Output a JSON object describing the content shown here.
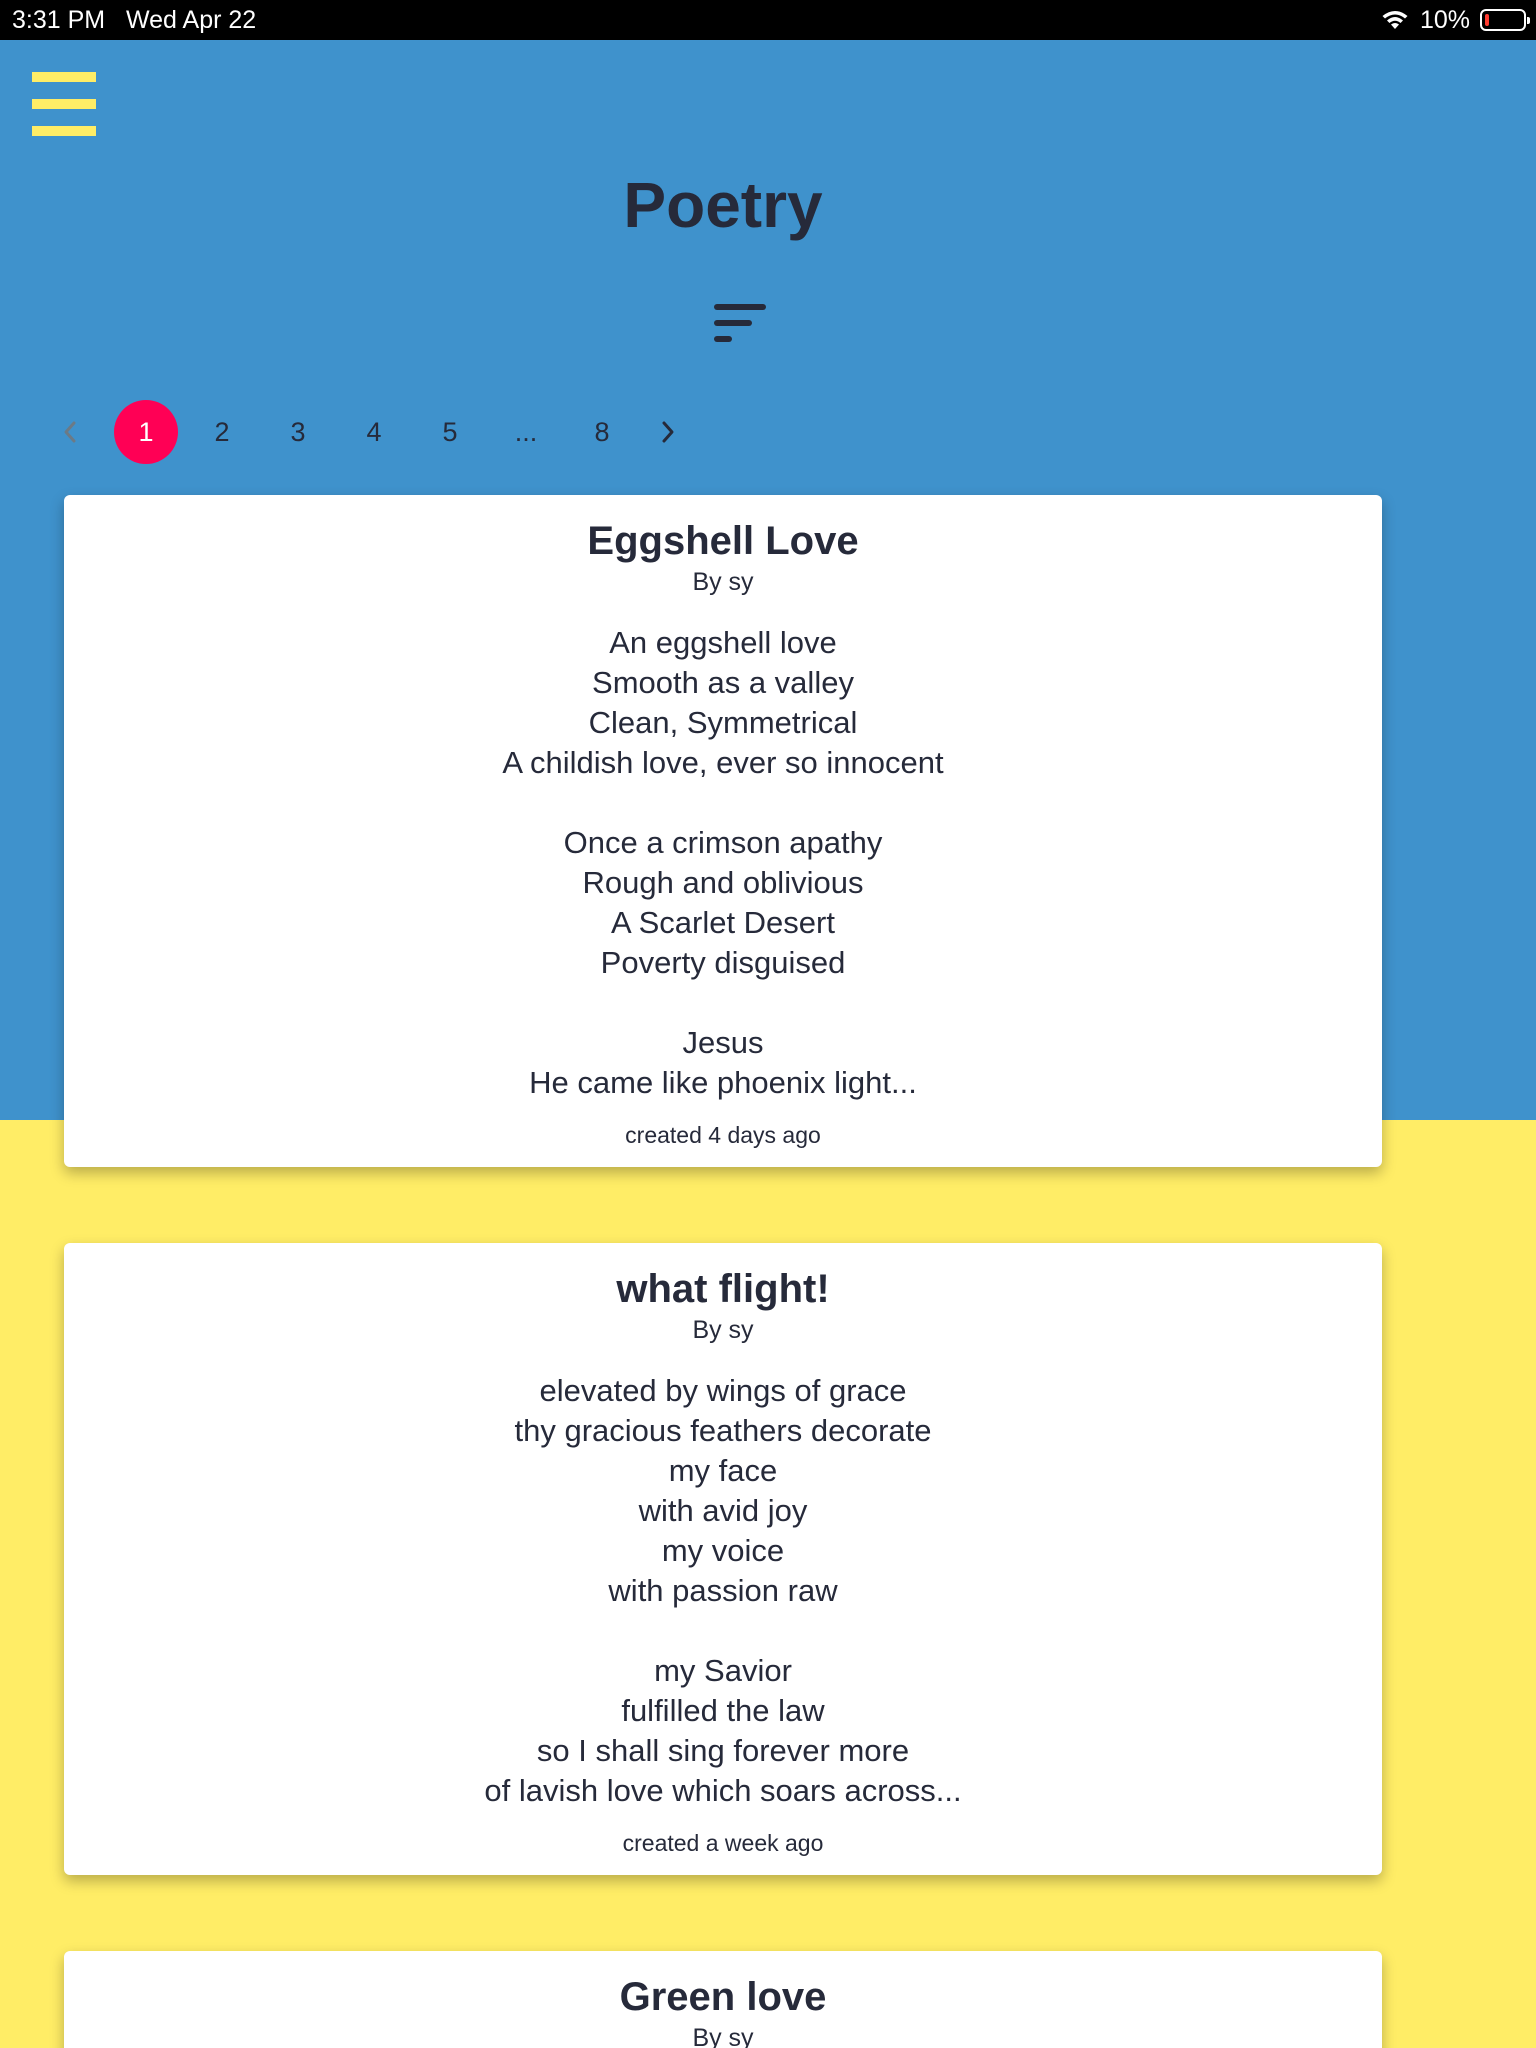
{
  "status_bar": {
    "time": "3:31 PM",
    "date": "Wed Apr 22",
    "battery": "10%",
    "battery_level": 0.1
  },
  "header": {
    "menu_icon": "hamburger-icon",
    "title": "Poetry",
    "sort_icon": "sort-icon"
  },
  "pagination": {
    "prev_icon": "chevron-left-icon",
    "next_icon": "chevron-right-icon",
    "pages": [
      "1",
      "2",
      "3",
      "4",
      "5",
      "...",
      "8"
    ],
    "active": "1"
  },
  "poems": [
    {
      "title": "Eggshell Love",
      "author": "By sy",
      "body": "An eggshell love\nSmooth as a valley\nClean, Symmetrical\nA childish love, ever so innocent\n\nOnce a crimson apathy\nRough and oblivious\nA Scarlet Desert\nPoverty disguised\n\nJesus\nHe came like phoenix light...",
      "created": "created 4 days ago"
    },
    {
      "title": "what flight!",
      "author": "By sy",
      "body": "elevated by wings of grace\nthy gracious feathers decorate\nmy face\nwith avid joy\nmy voice\nwith passion raw\n\nmy Savior\nfulfilled the law\nso I shall sing forever more\nof lavish love which soars across...",
      "created": "created a week ago"
    },
    {
      "title": "Green love",
      "author": "By sy"
    }
  ],
  "colors": {
    "header_bg": "#3f92cc",
    "page_bg": "#ffed66",
    "accent": "#ff0055",
    "text": "#262a3a",
    "menu_icon": "#ffed66"
  }
}
